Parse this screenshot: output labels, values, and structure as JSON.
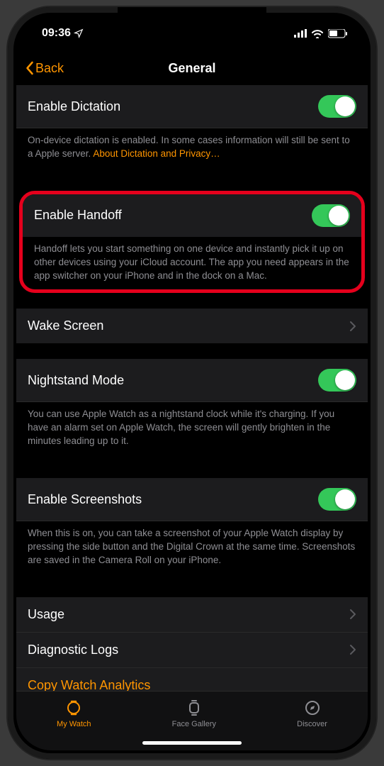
{
  "status": {
    "time": "09:36"
  },
  "nav": {
    "back": "Back",
    "title": "General"
  },
  "dictation": {
    "label": "Enable Dictation",
    "footer_a": "On-device dictation is enabled. In some cases information will still be sent to a Apple server. ",
    "footer_link": "About Dictation and Privacy…"
  },
  "handoff": {
    "label": "Enable Handoff",
    "footer": "Handoff lets you start something on one device and instantly pick it up on other devices using your iCloud account. The app you need appears in the app switcher on your iPhone and in the dock on a Mac."
  },
  "wake": {
    "label": "Wake Screen"
  },
  "nightstand": {
    "label": "Nightstand Mode",
    "footer": "You can use Apple Watch as a nightstand clock while it's charging. If you have an alarm set on Apple Watch, the screen will gently brighten in the minutes leading up to it."
  },
  "screenshots": {
    "label": "Enable Screenshots",
    "footer": "When this is on, you can take a screenshot of your Apple Watch display by pressing the side button and the Digital Crown at the same time. Screenshots are saved in the Camera Roll on your iPhone."
  },
  "usage": {
    "label": "Usage"
  },
  "diag": {
    "label": "Diagnostic Logs"
  },
  "copy": {
    "label": "Copy Watch Analytics"
  },
  "tabs": {
    "mywatch": "My Watch",
    "gallery": "Face Gallery",
    "discover": "Discover"
  }
}
